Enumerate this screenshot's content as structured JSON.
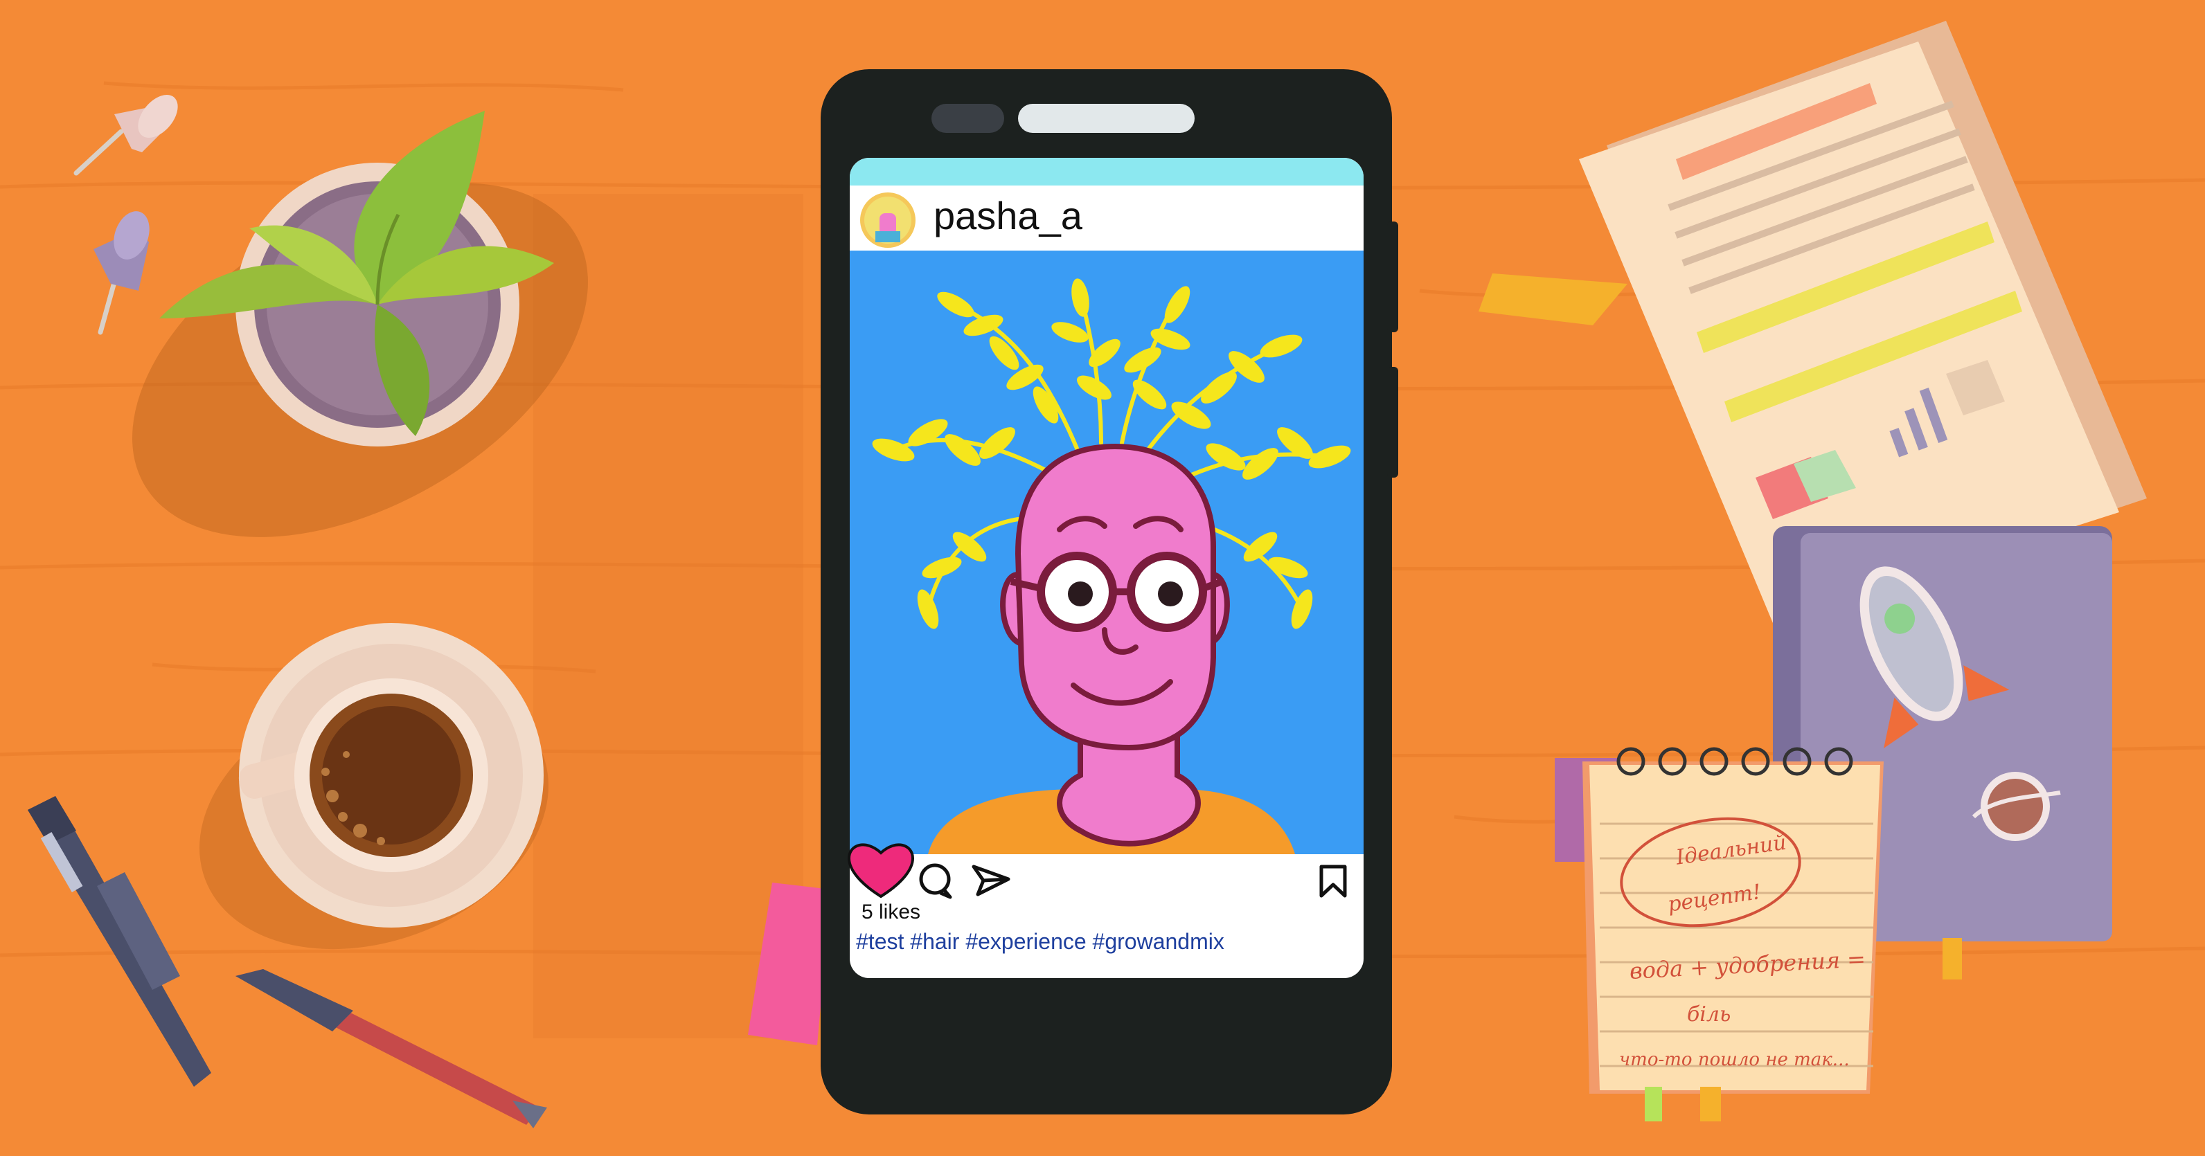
{
  "post": {
    "username": "pasha_a",
    "likes": "5 likes",
    "hashtags": "#test #hair #experience #growandmix"
  },
  "notepad": {
    "lines": [
      "Ідеальний",
      "рецепт!",
      "вода + удобрения =",
      "біль",
      "что-то пошло не так..."
    ]
  },
  "icons": [
    "heart-icon",
    "comment-icon",
    "share-icon",
    "bookmark-icon"
  ],
  "colors": {
    "desk": "#f48a36",
    "phone_body": "#1c211f",
    "photo_background": "#3a9cf4",
    "face": "#f07ccc",
    "leaves": "#f5e61c",
    "heart": "#ee2a7b",
    "hashtag": "#1e3f9e"
  }
}
